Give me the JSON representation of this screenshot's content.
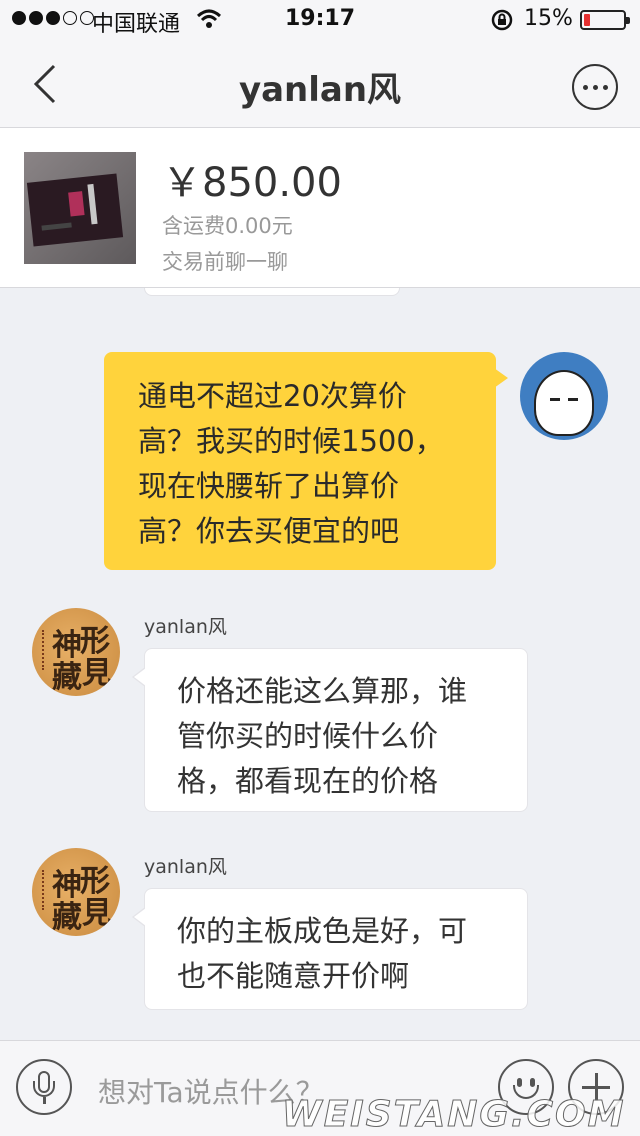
{
  "status_bar": {
    "carrier": "中国联通",
    "time": "19:17",
    "battery_percent": "15%",
    "battery_level": 0.15,
    "battery_color": "#e53030",
    "signal_bars": 3
  },
  "header": {
    "title": "yanlan风",
    "back_icon": "chevron-left-icon",
    "more_icon": "more-dots-icon"
  },
  "product": {
    "price": "￥850.00",
    "shipping": "含运费0.00元",
    "hint": "交易前聊一聊"
  },
  "messages": [
    {
      "side": "mine",
      "lines": [
        "通电不超过20次算价",
        "高？我买的时候1500，",
        "现在快腰斩了出算价",
        "高？你去买便宜的吧"
      ],
      "bubble_color": "#ffd33c"
    },
    {
      "side": "theirs",
      "sender": "yanlan风",
      "lines": [
        "价格还能这么算那，谁",
        "管你买的时候什么价",
        "格，都看现在的价格"
      ]
    },
    {
      "side": "theirs",
      "sender": "yanlan风",
      "lines": [
        "你的主板成色是好，可",
        "也不能随意开价啊"
      ]
    }
  ],
  "avatar_them_glyphs": [
    "神",
    "形",
    "藏",
    "見"
  ],
  "input_bar": {
    "placeholder": "想对Ta说点什么？",
    "voice_icon": "microphone-icon",
    "emoji_icon": "smiley-icon",
    "add_icon": "plus-icon"
  },
  "watermark": "WEISTANG.COM"
}
